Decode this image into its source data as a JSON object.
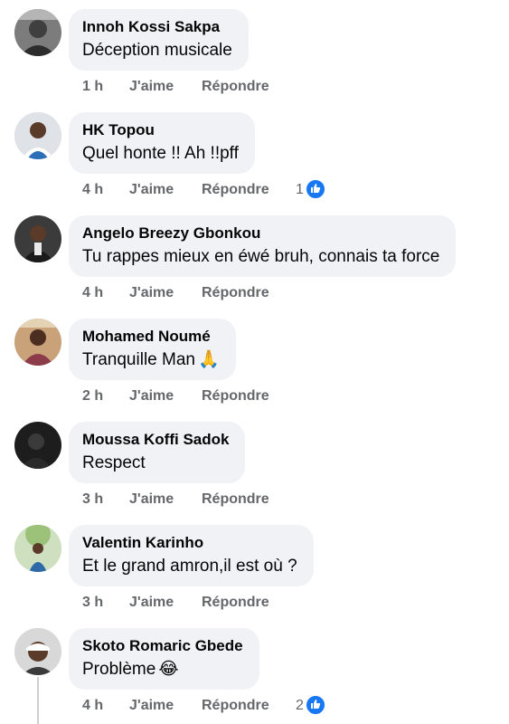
{
  "comments": [
    {
      "author": "Innoh Kossi Sakpa",
      "text": "Déception musicale",
      "emoji": "",
      "time": "1 h",
      "like_label": "J'aime",
      "reply_label": "Répondre",
      "reactions": "",
      "avatar_color": "#8a8a8a"
    },
    {
      "author": "HK Topou",
      "text": "Quel honte !! Ah !!pff",
      "emoji": "",
      "time": "4 h",
      "like_label": "J'aime",
      "reply_label": "Répondre",
      "reactions": "1",
      "avatar_color": "#d9dde2"
    },
    {
      "author": "Angelo Breezy Gbonkou",
      "text": "Tu rappes mieux en éwé bruh, connais ta force",
      "emoji": "",
      "time": "4 h",
      "like_label": "J'aime",
      "reply_label": "Répondre",
      "reactions": "",
      "avatar_color": "#2b2b2b"
    },
    {
      "author": "Mohamed Noumé",
      "text": "Tranquille Man",
      "emoji": "🙏",
      "time": "2 h",
      "like_label": "J'aime",
      "reply_label": "Répondre",
      "reactions": "",
      "avatar_color": "#a8744f"
    },
    {
      "author": "Moussa Koffi Sadok",
      "text": "Respect",
      "emoji": "",
      "time": "3 h",
      "like_label": "J'aime",
      "reply_label": "Répondre",
      "reactions": "",
      "avatar_color": "#1c1c1c"
    },
    {
      "author": "Valentin Karinho",
      "text": "Et le grand amron,il est où ?",
      "emoji": "",
      "time": "3 h",
      "like_label": "J'aime",
      "reply_label": "Répondre",
      "reactions": "",
      "avatar_color": "#bcd6a6"
    },
    {
      "author": "Skoto Romaric Gbede",
      "text": "Problème",
      "emoji": "😂",
      "time": "4 h",
      "like_label": "J'aime",
      "reply_label": "Répondre",
      "reactions": "2",
      "avatar_color": "#3a3a3a"
    }
  ],
  "colors": {
    "bubble": "#f0f2f5",
    "meta": "#65676b",
    "like_badge": "#1877f2"
  }
}
